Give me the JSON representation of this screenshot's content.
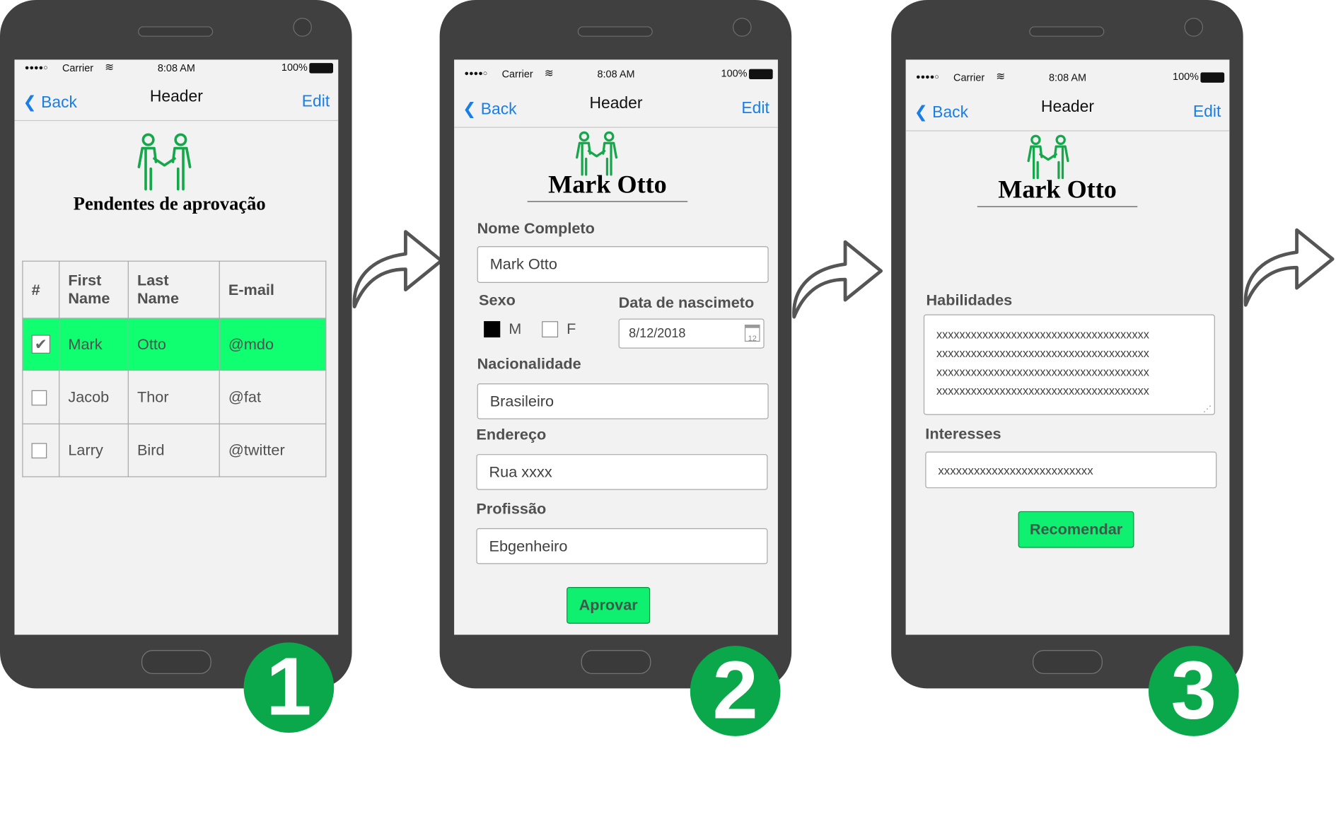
{
  "status": {
    "carrier": "Carrier",
    "time": "8:08 AM",
    "battery": "100%"
  },
  "nav": {
    "back": "Back",
    "title": "Header",
    "edit": "Edit"
  },
  "screen1": {
    "title": "Pendentes de aprovação",
    "table": {
      "headers": [
        "#",
        "First Name",
        "Last Name",
        "E-mail"
      ],
      "rows": [
        {
          "first": "Mark",
          "last": "Otto",
          "email": "@mdo",
          "checked": true
        },
        {
          "first": "Jacob",
          "last": "Thor",
          "email": "@fat",
          "checked": false
        },
        {
          "first": "Larry",
          "last": "Bird",
          "email": "@twitter",
          "checked": false
        }
      ]
    },
    "badge": "1"
  },
  "screen2": {
    "name": "Mark Otto",
    "nome_label": "Nome Completo",
    "nome_value": "Mark Otto",
    "sexo_label": "Sexo",
    "sexo_m": "M",
    "sexo_f": "F",
    "data_label": "Data de nascimeto",
    "data_value": "8/12/2018",
    "data_icon_text": "12",
    "nac_label": "Nacionalidade",
    "nac_value": "Brasileiro",
    "end_label": "Endereço",
    "end_value": "Rua xxxx",
    "prof_label": "Profissão",
    "prof_value": "Ebgenheiro",
    "button": "Aprovar",
    "badge": "2"
  },
  "screen3": {
    "name": "Mark Otto",
    "hab_label": "Habilidades",
    "hab_lines": [
      "xxxxxxxxxxxxxxxxxxxxxxxxxxxxxxxxxxxxx",
      "xxxxxxxxxxxxxxxxxxxxxxxxxxxxxxxxxxxxx",
      "xxxxxxxxxxxxxxxxxxxxxxxxxxxxxxxxxxxxx",
      "xxxxxxxxxxxxxxxxxxxxxxxxxxxxxxxxxxxxx"
    ],
    "int_label": "Interesses",
    "int_value": "xxxxxxxxxxxxxxxxxxxxxxxxxx",
    "button": "Recomendar",
    "badge": "3"
  },
  "colors": {
    "accent_green": "#10f070",
    "badge_green": "#0aa84a",
    "link_blue": "#1a7ee6",
    "phone": "#404040"
  },
  "icons": {
    "people": "handshake-people-icon",
    "back": "chevron-left-icon",
    "calendar": "calendar-icon",
    "next": "curved-arrow-right-icon"
  }
}
